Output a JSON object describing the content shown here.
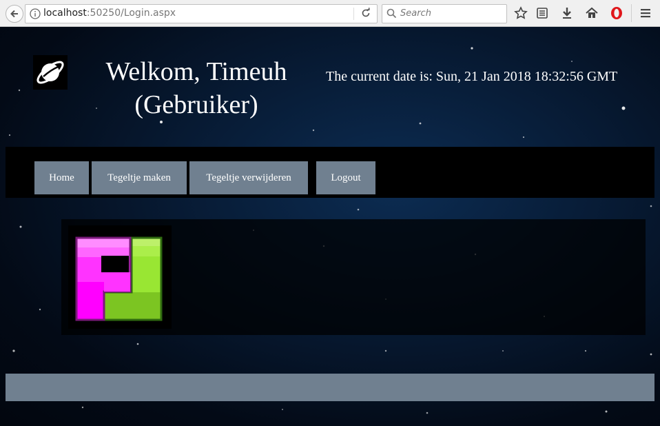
{
  "browser": {
    "url_host": "localhost",
    "url_rest": ":50250/Login.aspx",
    "search_placeholder": "Search"
  },
  "header": {
    "welcome_line1": "Welkom, Timeuh",
    "welcome_line2": "(Gebruiker)",
    "date_text": "The current date is: Sun, 21 Jan 2018 18:32:56 GMT"
  },
  "nav": {
    "items": [
      {
        "label": "Home"
      },
      {
        "label": "Tegeltje maken"
      },
      {
        "label": "Tegeltje verwijderen"
      },
      {
        "label": "Logout"
      }
    ]
  },
  "colors": {
    "nav_button": "#708090",
    "tile_pink": "#ff33ff",
    "tile_green": "#99e633"
  },
  "icons": [
    "back-arrow-icon",
    "info-icon",
    "reload-icon",
    "search-icon",
    "star-icon",
    "reading-list-icon",
    "download-icon",
    "home-icon",
    "opera-icon",
    "menu-icon",
    "planet-logo-icon"
  ]
}
